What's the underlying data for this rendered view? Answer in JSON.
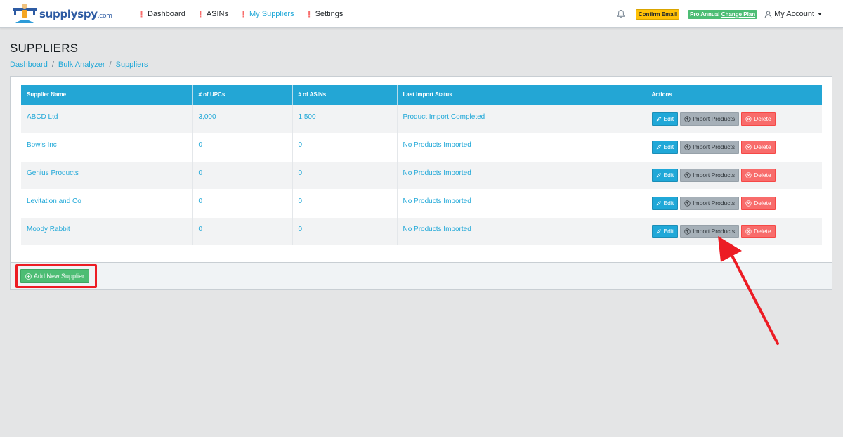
{
  "brand": {
    "name": "supplyspy",
    "suffix": ".com"
  },
  "nav": {
    "items": [
      {
        "label": "Dashboard"
      },
      {
        "label": "ASINs"
      },
      {
        "label": "My Suppliers"
      },
      {
        "label": "Settings"
      }
    ],
    "active": "My Suppliers"
  },
  "header_right": {
    "bell_icon": "bell-icon",
    "confirm_email": "Confirm Email",
    "plan_label": "Pro Annual",
    "change_plan": "Change Plan",
    "account": "My Account"
  },
  "page": {
    "title": "SUPPLIERS",
    "breadcrumb": [
      "Dashboard",
      "Bulk Analyzer",
      "Suppliers"
    ]
  },
  "table": {
    "headers": [
      "Supplier Name",
      "# of UPCs",
      "# of ASINs",
      "Last Import Status",
      "Actions"
    ],
    "rows": [
      {
        "name": "ABCD Ltd",
        "upcs": "3,000",
        "asins": "1,500",
        "status": "Product Import Completed"
      },
      {
        "name": "Bowls Inc",
        "upcs": "0",
        "asins": "0",
        "status": "No Products Imported"
      },
      {
        "name": "Genius Products",
        "upcs": "0",
        "asins": "0",
        "status": "No Products Imported"
      },
      {
        "name": "Levitation and Co",
        "upcs": "0",
        "asins": "0",
        "status": "No Products Imported"
      },
      {
        "name": "Moody Rabbit",
        "upcs": "0",
        "asins": "0",
        "status": "No Products Imported"
      }
    ],
    "actions": {
      "edit": "Edit",
      "import": "Import Products",
      "delete": "Delete"
    }
  },
  "footer": {
    "add_button": "Add New Supplier"
  },
  "colors": {
    "primary": "#20a8d8",
    "success": "#4dbd74",
    "danger": "#f86c6b",
    "warning": "#ffc107",
    "annotation": "#ec1c24"
  }
}
